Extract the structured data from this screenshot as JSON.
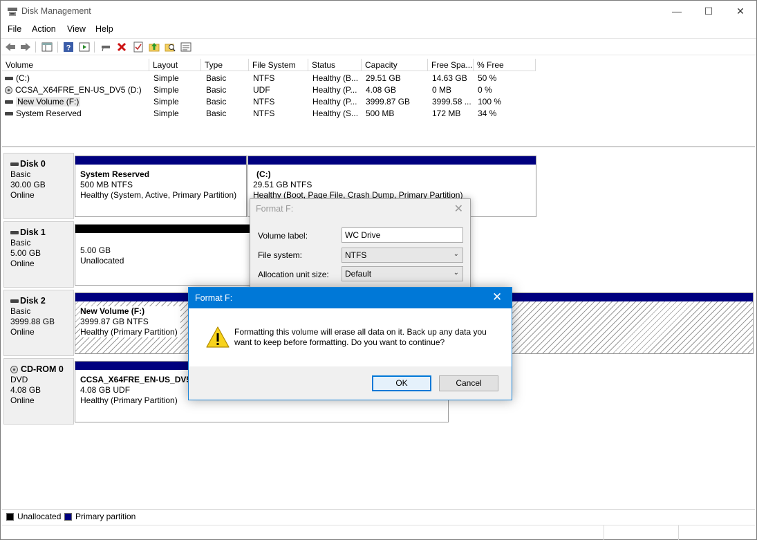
{
  "window": {
    "title": "Disk Management"
  },
  "menu": [
    "File",
    "Action",
    "View",
    "Help"
  ],
  "toolbar": {
    "icons": [
      "back-arrow-icon",
      "forward-arrow-icon",
      "console-view-icon",
      "help-icon",
      "help-topics-icon",
      "connect-drive-icon",
      "delete-icon",
      "checklist-icon",
      "folder-up-icon",
      "search-folder-icon",
      "properties-icon"
    ]
  },
  "volume_list": {
    "headers": [
      "Volume",
      "Layout",
      "Type",
      "File System",
      "Status",
      "Capacity",
      "Free Spa...",
      "% Free"
    ],
    "rows": [
      {
        "volume": "(C:)",
        "layout": "Simple",
        "type": "Basic",
        "fs": "NTFS",
        "status": "Healthy (B...",
        "capacity": "29.51 GB",
        "free": "14.63 GB",
        "pct": "50 %",
        "icon": "drive-icon"
      },
      {
        "volume": "CCSA_X64FRE_EN-US_DV5 (D:)",
        "layout": "Simple",
        "type": "Basic",
        "fs": "UDF",
        "status": "Healthy (P...",
        "capacity": "4.08 GB",
        "free": "0 MB",
        "pct": "0 %",
        "icon": "cd-icon"
      },
      {
        "volume": "New Volume (F:)",
        "layout": "Simple",
        "type": "Basic",
        "fs": "NTFS",
        "status": "Healthy (P...",
        "capacity": "3999.87 GB",
        "free": "3999.58 ...",
        "pct": "100 %",
        "icon": "drive-icon"
      },
      {
        "volume": "System Reserved",
        "layout": "Simple",
        "type": "Basic",
        "fs": "NTFS",
        "status": "Healthy (S...",
        "capacity": "500 MB",
        "free": "172 MB",
        "pct": "34 %",
        "icon": "drive-icon"
      }
    ]
  },
  "disks": [
    {
      "name": "Disk 0",
      "type": "Basic",
      "size": "30.00 GB",
      "state": "Online",
      "partitions": [
        {
          "title": "System Reserved",
          "size": "500 MB NTFS",
          "status": "Healthy (System, Active, Primary Partition)"
        },
        {
          "title": "(C:)",
          "size": "29.51 GB NTFS",
          "status": "Healthy (Boot, Page File, Crash Dump, Primary Partition)"
        }
      ]
    },
    {
      "name": "Disk 1",
      "type": "Basic",
      "size": "5.00 GB",
      "state": "Online",
      "partitions": [
        {
          "size": "5.00 GB",
          "status": "Unallocated"
        }
      ]
    },
    {
      "name": "Disk 2",
      "type": "Basic",
      "size": "3999.88 GB",
      "state": "Online",
      "partitions": [
        {
          "title": "New Volume  (F:)",
          "size": "3999.87 GB NTFS",
          "status": "Healthy (Primary Partition)"
        }
      ]
    },
    {
      "name": "CD-ROM 0",
      "type": "DVD",
      "size": "4.08 GB",
      "state": "Online",
      "partitions": [
        {
          "title": "CCSA_X64FRE_EN-US_DV5  (",
          "size": "4.08 GB UDF",
          "status": "Healthy (Primary Partition)"
        }
      ]
    }
  ],
  "legend": [
    {
      "label": "Unallocated",
      "color": "#000000"
    },
    {
      "label": "Primary partition",
      "color": "#00007f"
    }
  ],
  "format_dialog": {
    "title": "Format F:",
    "volume_label_label": "Volume label:",
    "volume_label_value": "WC Drive",
    "file_system_label": "File system:",
    "file_system_value": "NTFS",
    "alloc_label": "Allocation unit size:",
    "alloc_value": "Default"
  },
  "confirm_dialog": {
    "title": "Format F:",
    "message": "Formatting this volume will erase all data on it. Back up any data you want to keep before formatting. Do you want to continue?",
    "ok": "OK",
    "cancel": "Cancel"
  },
  "colors": {
    "accent": "#0078d7",
    "primary_partition": "#00007f"
  }
}
